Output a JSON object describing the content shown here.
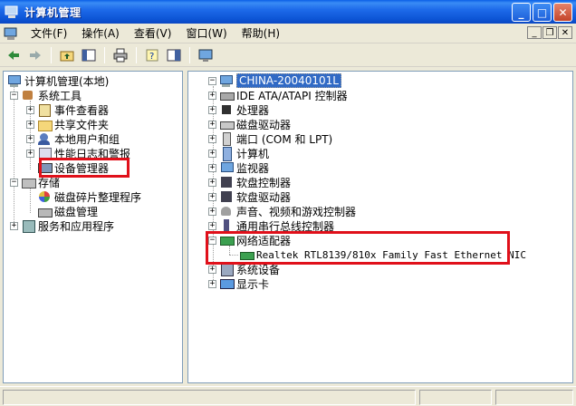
{
  "window": {
    "title": "计算机管理"
  },
  "menu": [
    {
      "label": "文件(F)"
    },
    {
      "label": "操作(A)"
    },
    {
      "label": "查看(V)"
    },
    {
      "label": "窗口(W)"
    },
    {
      "label": "帮助(H)"
    }
  ],
  "caption": {
    "minimize": "_",
    "maximize": "□",
    "close": "✕"
  },
  "mdi": {
    "minimize": "_",
    "restore": "❐",
    "close": "✕"
  },
  "toolbar_icons": [
    "back-arrow-icon",
    "forward-arrow-icon",
    "up-folder-icon",
    "show-tree-icon",
    "print-icon",
    "help-icon",
    "properties-icon",
    "device-icon"
  ],
  "left_tree": [
    {
      "id": "root",
      "label": "计算机管理(本地)",
      "expander": "",
      "icon": "ico-computer"
    },
    {
      "id": "systools",
      "label": "系统工具",
      "expander": "−",
      "icon": "ico-tools"
    },
    {
      "id": "eventviewer",
      "label": "事件查看器",
      "expander": "+",
      "icon": "ico-event"
    },
    {
      "id": "shared",
      "label": "共享文件夹",
      "expander": "+",
      "icon": "ico-folder"
    },
    {
      "id": "localusers",
      "label": "本地用户和组",
      "expander": "+",
      "icon": "ico-users"
    },
    {
      "id": "perflogs",
      "label": "性能日志和警报",
      "expander": "+",
      "icon": "ico-perf"
    },
    {
      "id": "devmgr",
      "label": "设备管理器",
      "expander": "",
      "icon": "ico-devmgr"
    },
    {
      "id": "storage",
      "label": "存储",
      "expander": "−",
      "icon": "ico-storage"
    },
    {
      "id": "defrag",
      "label": "磁盘碎片整理程序",
      "expander": "",
      "icon": "ico-defrag"
    },
    {
      "id": "diskmgmt",
      "label": "磁盘管理",
      "expander": "",
      "icon": "ico-disk"
    },
    {
      "id": "services",
      "label": "服务和应用程序",
      "expander": "+",
      "icon": "ico-services"
    }
  ],
  "right_tree": [
    {
      "id": "computer",
      "label": "CHINA-20040101L",
      "expander": "−",
      "icon": "ico-computer"
    },
    {
      "id": "ide",
      "label": "IDE ATA/ATAPI 控制器",
      "expander": "+",
      "icon": "ico-ide"
    },
    {
      "id": "cpu",
      "label": "处理器",
      "expander": "+",
      "icon": "ico-cpu"
    },
    {
      "id": "diskdrive",
      "label": "磁盘驱动器",
      "expander": "+",
      "icon": "ico-drive"
    },
    {
      "id": "ports",
      "label": "端口 (COM 和 LPT)",
      "expander": "+",
      "icon": "ico-port"
    },
    {
      "id": "pc",
      "label": "计算机",
      "expander": "+",
      "icon": "ico-pc"
    },
    {
      "id": "monitor",
      "label": "监视器",
      "expander": "+",
      "icon": "ico-monitor"
    },
    {
      "id": "floppyctl",
      "label": "软盘控制器",
      "expander": "+",
      "icon": "ico-floppy"
    },
    {
      "id": "floppydrv",
      "label": "软盘驱动器",
      "expander": "+",
      "icon": "ico-floppy"
    },
    {
      "id": "sound",
      "label": "声音、视频和游戏控制器",
      "expander": "+",
      "icon": "ico-sound"
    },
    {
      "id": "usb",
      "label": "通用串行总线控制器",
      "expander": "+",
      "icon": "ico-usb"
    },
    {
      "id": "netadapters",
      "label": "网络适配器",
      "expander": "−",
      "icon": "ico-net"
    },
    {
      "id": "nic",
      "label": "Realtek RTL8139/810x Family Fast Ethernet NIC",
      "expander": "",
      "icon": "ico-nic"
    },
    {
      "id": "sysdev",
      "label": "系统设备",
      "expander": "+",
      "icon": "ico-sys"
    },
    {
      "id": "display",
      "label": "显示卡",
      "expander": "+",
      "icon": "ico-display"
    }
  ],
  "colors": {
    "highlight": "#E0101A",
    "selection": "#316AC5",
    "titlebar": "#0D55D6"
  }
}
